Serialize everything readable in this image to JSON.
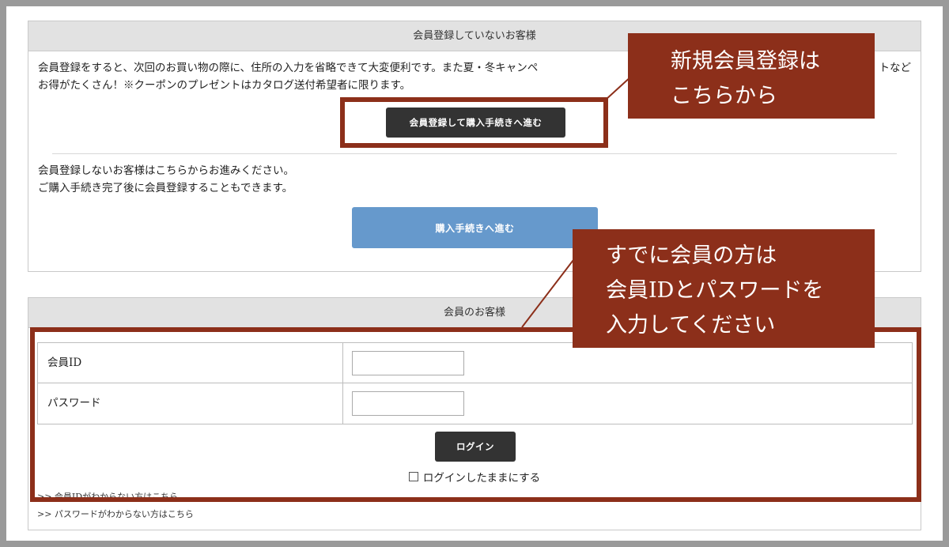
{
  "guest": {
    "header": "会員登録していないお客様",
    "intro_line1": "会員登録をすると、次回のお買い物の際に、住所の入力を省略できて大変便利です。また夏・冬キャンペ",
    "intro_line1_tail": "トなど",
    "intro_line2": "お得がたくさん！※クーポンのプレゼントはカタログ送付希望者に限ります。",
    "register_button": "会員登録して購入手続きへ進む",
    "no_register_line1": "会員登録しないお客様はこちらからお進みください。",
    "no_register_line2": "ご購入手続き完了後に会員登録することもできます。",
    "proceed_button": "購入手続きへ進む"
  },
  "member": {
    "header": "会員のお客様",
    "id_label": "会員ID",
    "password_label": "パスワード",
    "id_value": "",
    "password_value": "",
    "login_button": "ログイン",
    "remember_label": "ログインしたままにする",
    "forgot_id_link": ">> 会員IDがわからない方はこちら",
    "forgot_password_link": ">> パスワードがわからない方はこちら"
  },
  "callouts": {
    "register": {
      "line1": "新規会員登録は",
      "line2": "こちらから"
    },
    "login": {
      "line1": "すでに会員の方は",
      "line2": "会員IDとパスワードを",
      "line3": "入力してください"
    }
  },
  "colors": {
    "callout_bg": "#8c2f1a",
    "dark_button": "#333333",
    "blue_button": "#6699cc",
    "header_bg": "#e2e2e2"
  }
}
